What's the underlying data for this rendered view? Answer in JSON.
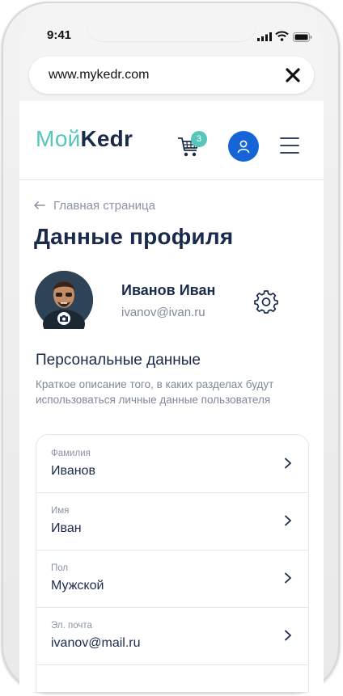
{
  "status_bar": {
    "time": "9:41"
  },
  "browser": {
    "url": "www.mykedr.com"
  },
  "header": {
    "logo_part1": "Мой",
    "logo_part2": "Kedr",
    "cart_count": "3",
    "accent_color": "#55c6b8",
    "brand_dark": "#1a2a4a",
    "user_button_color": "#1565d8"
  },
  "breadcrumb": {
    "label": "Главная страница"
  },
  "page": {
    "title": "Данные профиля"
  },
  "profile": {
    "name": "Иванов Иван",
    "email": "ivanov@ivan.ru"
  },
  "section": {
    "title": "Персональные данные",
    "description": "Краткое описание того, в каких разделах будут использоваться личные данные пользователя"
  },
  "fields": [
    {
      "label": "Фамилия",
      "value": "Иванов"
    },
    {
      "label": "Имя",
      "value": "Иван"
    },
    {
      "label": "Пол",
      "value": "Мужской"
    },
    {
      "label": "Эл. почта",
      "value": "ivanov@mail.ru"
    }
  ]
}
